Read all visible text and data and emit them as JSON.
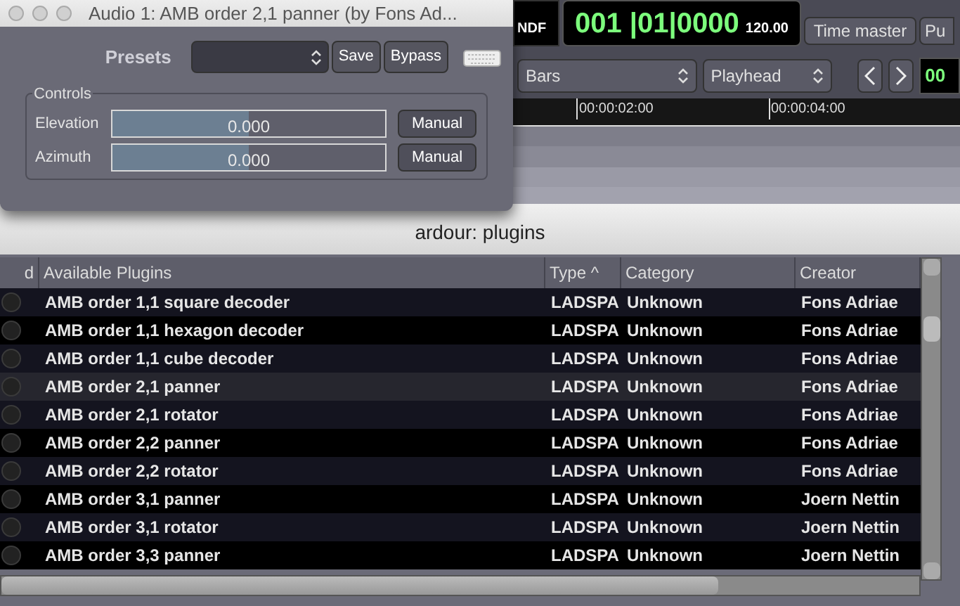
{
  "editor": {
    "timecode_flag": "NDF",
    "clock": "001 |01|0000",
    "tempo": "120.00",
    "time_master_button": "Time master",
    "cut_button": "Pu",
    "grid_select": "Bars",
    "edit_point_select": "Playhead",
    "clock_2": "00",
    "ruler_marks": [
      "00:00:02:00",
      "00:00:04:00"
    ]
  },
  "plugin_dialog": {
    "title": "Audio 1: AMB order 2,1 panner (by Fons Ad...",
    "presets_label": "Presets",
    "save_button": "Save",
    "bypass_button": "Bypass",
    "controls_group": "Controls",
    "controls": [
      {
        "label": "Elevation",
        "value": "0.000",
        "level": 0.5,
        "button": "Manual"
      },
      {
        "label": "Azimuth",
        "value": "0.000",
        "level": 0.5,
        "button": "Manual"
      }
    ]
  },
  "plugins_window": {
    "title": "ardour: plugins",
    "table": {
      "columns": [
        "d",
        "Available Plugins",
        "Type ^",
        "Category",
        "Creator"
      ],
      "rows": [
        {
          "name": "AMB order 1,1 square decoder",
          "type": "LADSPA",
          "category": "Unknown",
          "creator": "Fons Adriae",
          "selected": false
        },
        {
          "name": "AMB order 1,1 hexagon decoder",
          "type": "LADSPA",
          "category": "Unknown",
          "creator": "Fons Adriae",
          "selected": false
        },
        {
          "name": "AMB order 1,1 cube decoder",
          "type": "LADSPA",
          "category": "Unknown",
          "creator": "Fons Adriae",
          "selected": false
        },
        {
          "name": "AMB order 2,1 panner",
          "type": "LADSPA",
          "category": "Unknown",
          "creator": "Fons Adriae",
          "selected": true
        },
        {
          "name": "AMB order 2,1 rotator",
          "type": "LADSPA",
          "category": "Unknown",
          "creator": "Fons Adriae",
          "selected": false
        },
        {
          "name": "AMB order 2,2 panner",
          "type": "LADSPA",
          "category": "Unknown",
          "creator": "Fons Adriae",
          "selected": false
        },
        {
          "name": "AMB order 2,2 rotator",
          "type": "LADSPA",
          "category": "Unknown",
          "creator": "Fons Adriae",
          "selected": false
        },
        {
          "name": "AMB order 3,1 panner",
          "type": "LADSPA",
          "category": "Unknown",
          "creator": "Joern Nettin",
          "selected": false
        },
        {
          "name": "AMB order 3,1 rotator",
          "type": "LADSPA",
          "category": "Unknown",
          "creator": "Joern Nettin",
          "selected": false
        },
        {
          "name": "AMB order 3,3 panner",
          "type": "LADSPA",
          "category": "Unknown",
          "creator": "Joern Nettin",
          "selected": false
        }
      ]
    }
  }
}
